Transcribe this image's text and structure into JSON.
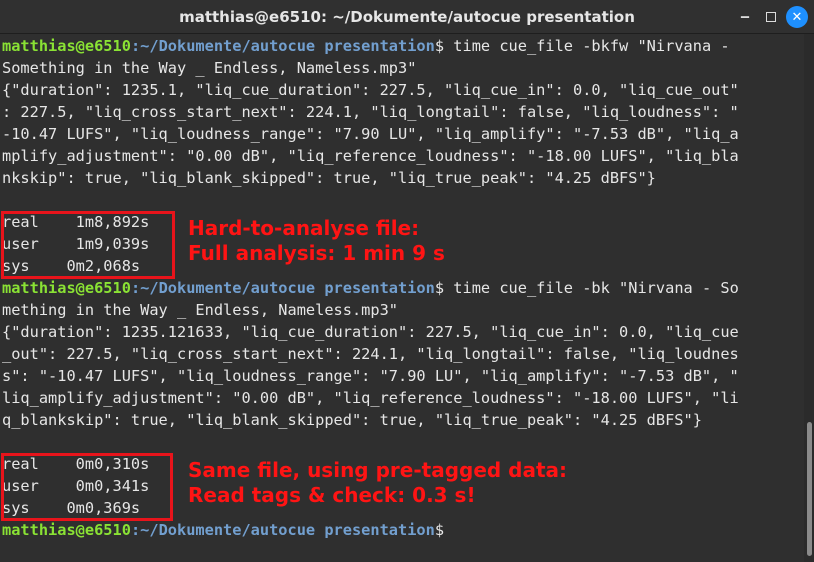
{
  "window": {
    "title": "matthias@e6510: ~/Dokumente/autocue presentation",
    "minimize": "‒",
    "close": "✕"
  },
  "prompt": {
    "user": "matthias@e6510",
    "path": ":~/Dokumente/autocue presentation",
    "dollar": "$"
  },
  "session1": {
    "cmd": " time cue_file -bkfw \"Nirvana -",
    "cmd_cont": "Something in the Way _ Endless, Nameless.mp3\"",
    "output": [
      "{\"duration\": 1235.1, \"liq_cue_duration\": 227.5, \"liq_cue_in\": 0.0, \"liq_cue_out\"",
      ": 227.5, \"liq_cross_start_next\": 224.1, \"liq_longtail\": false, \"liq_loudness\": \"",
      "-10.47 LUFS\", \"liq_loudness_range\": \"7.90 LU\", \"liq_amplify\": \"-7.53 dB\", \"liq_a",
      "mplify_adjustment\": \"0.00 dB\", \"liq_reference_loudness\": \"-18.00 LUFS\", \"liq_bla",
      "nkskip\": true, \"liq_blank_skipped\": true, \"liq_true_peak\": \"4.25 dBFS\"}"
    ],
    "times": [
      "real\t1m8,892s",
      "user\t1m9,039s",
      "sys\t0m2,068s"
    ],
    "note": [
      "Hard-to-analyse file:",
      "Full analysis: 1 min 9 s"
    ]
  },
  "session2": {
    "cmd": " time cue_file -bk \"Nirvana - So",
    "cmd_cont": "mething in the Way _ Endless, Nameless.mp3\"",
    "output": [
      "{\"duration\": 1235.121633, \"liq_cue_duration\": 227.5, \"liq_cue_in\": 0.0, \"liq_cue",
      "_out\": 227.5, \"liq_cross_start_next\": 224.1, \"liq_longtail\": false, \"liq_loudnes",
      "s\": \"-10.47 LUFS\", \"liq_loudness_range\": \"7.90 LU\", \"liq_amplify\": \"-7.53 dB\", \"",
      "liq_amplify_adjustment\": \"0.00 dB\", \"liq_reference_loudness\": \"-18.00 LUFS\", \"li",
      "q_blankskip\": true, \"liq_blank_skipped\": true, \"liq_true_peak\": \"4.25 dBFS\"}"
    ],
    "times": [
      "real\t0m0,310s",
      "user\t0m0,341s",
      "sys\t0m0,369s"
    ],
    "note": [
      "Same file, using pre-tagged data:",
      "Read tags & check: 0.3 s!"
    ]
  }
}
